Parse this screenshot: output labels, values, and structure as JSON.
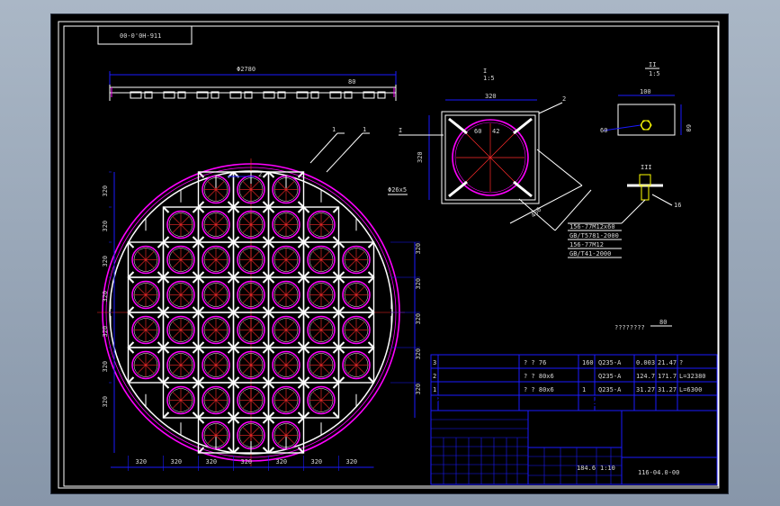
{
  "drawing": {
    "drawing_number_top": "00-0'0H-911",
    "drawing_number": "116-04.0-00",
    "outer_diameter": "Φ2780",
    "side_pitch": "80",
    "pipe_callout": "Φ26x5",
    "detail_I_label": "I",
    "detail_I_scale": "1:5",
    "detail_II_label": "II",
    "detail_II_scale": "1:5",
    "detail_I_width": "320",
    "detail_I_height": "320",
    "detail_I_diag": "460",
    "detail_I_leader": "I",
    "detail_I_leader2": "2",
    "detail_I_dim_a": "60",
    "detail_I_dim_b": "42",
    "detail_II_width": "100",
    "detail_II_height": "60",
    "detail_II_left": "60",
    "detail_III_label": "III",
    "detail_III_note": "16",
    "detail_bolt_notes": [
      "156-77M12x60",
      "GB/T5781-2000",
      "156-77M12",
      "GB/T41-2000"
    ],
    "note_line": "????????",
    "note_scale": "80",
    "balloons": [
      "1",
      "1",
      "2"
    ],
    "left_dims": [
      "320",
      "320",
      "320",
      "320",
      "320",
      "320",
      "320"
    ],
    "right_dims": [
      "320",
      "320",
      "320",
      "320",
      "320"
    ],
    "bottom_dims": [
      "320",
      "320",
      "320",
      "320",
      "320",
      "320",
      "320"
    ]
  },
  "bom": {
    "rows": [
      {
        "no": "3",
        "name": "? ? 76",
        "qty": "160",
        "material": "Q235-A",
        "unit": "0.003",
        "total": "21.47",
        "note": "?"
      },
      {
        "no": "2",
        "name": "? ? 80x6",
        "qty": "",
        "material": "Q235-A",
        "unit": "124.7",
        "total": "171.7",
        "note": "L=32380"
      },
      {
        "no": "1",
        "name": "? ? 80x6",
        "qty": "1",
        "material": "Q235-A",
        "unit": "31.27",
        "total": "31.27",
        "note": "L=6300"
      }
    ],
    "header": [
      "??",
      "??",
      "??",
      "??",
      "??",
      "??",
      "??"
    ]
  },
  "title_block": {
    "title_cells": [
      "?",
      "?",
      "?"
    ],
    "company_cells": [
      "?",
      "?",
      "?"
    ],
    "scale": "1:10",
    "weight": "184.6",
    "drawing_no": "116-04.0-00"
  },
  "colors": {
    "background": "#000000",
    "frame": "#ffffff",
    "dimension": "#1a1aff",
    "rings": "#ff00ff",
    "centerline": "#ff2a2a",
    "text": "#d8d8d8"
  }
}
